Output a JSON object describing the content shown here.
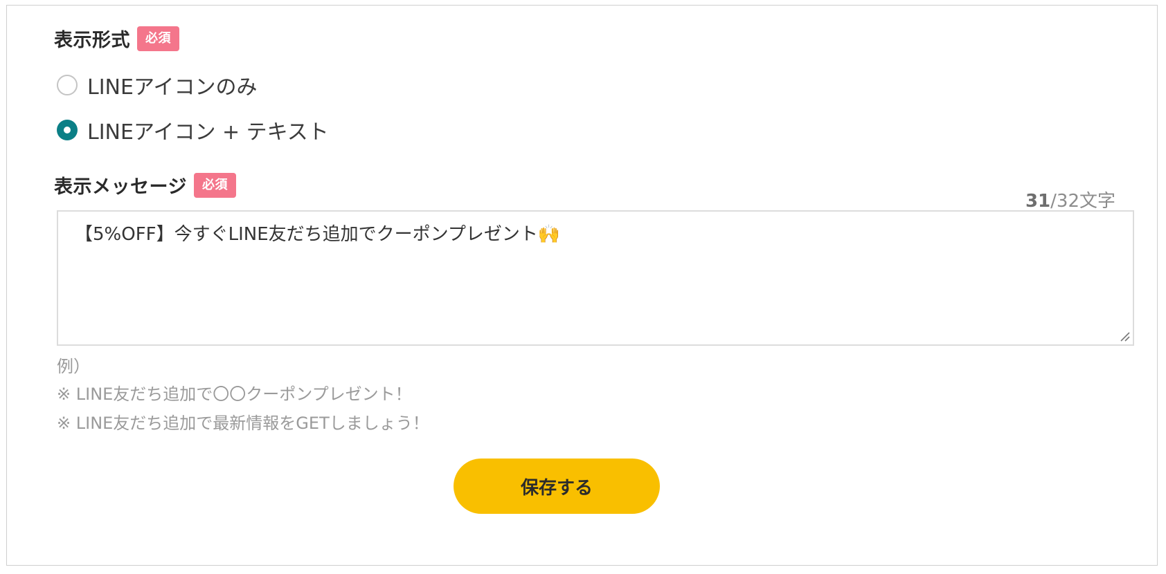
{
  "display_format": {
    "label": "表示形式",
    "required_badge": "必須",
    "options": [
      {
        "label": "LINEアイコンのみ",
        "checked": false
      },
      {
        "label": "LINEアイコン + テキスト",
        "checked": true
      }
    ]
  },
  "display_message": {
    "label": "表示メッセージ",
    "required_badge": "必須",
    "counter_current": "31",
    "counter_total": "/32文字",
    "value": "【5%OFF】今すぐLINE友だち追加でクーポンプレゼント🙌",
    "examples_heading": "例）",
    "examples": [
      "※ LINE友だち追加で〇〇クーポンプレゼント！",
      "※ LINE友だち追加で最新情報をGETしましょう！"
    ]
  },
  "save_button_label": "保存する",
  "colors": {
    "accent_radio": "#0b7f86",
    "badge": "#f4768b",
    "button": "#f9bf00"
  }
}
